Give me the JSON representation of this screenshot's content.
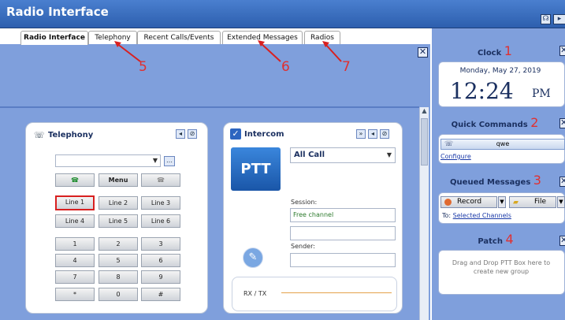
{
  "app": {
    "title": "Radio Interface"
  },
  "tabs": [
    {
      "label": "Radio Interface",
      "active": true
    },
    {
      "label": "Telephony",
      "active": false
    },
    {
      "label": "Recent Calls/Events",
      "active": false
    },
    {
      "label": "Extended Messages",
      "active": false
    },
    {
      "label": "Radios",
      "active": false
    }
  ],
  "telephony": {
    "title": "Telephony",
    "menu_label": "Menu",
    "lines": [
      "Line 1",
      "Line 2",
      "Line 3",
      "Line 4",
      "Line 5",
      "Line 6"
    ],
    "selected_line": "Line 1",
    "keypad": [
      "1",
      "2",
      "3",
      "4",
      "5",
      "6",
      "7",
      "8",
      "9",
      "*",
      "0",
      "#"
    ]
  },
  "intercom": {
    "title": "Intercom",
    "ptt_label": "PTT",
    "group_select": "All Call",
    "session_label": "Session:",
    "session_value": "Free channel",
    "sender_label": "Sender:",
    "rxtx_label": "RX / TX"
  },
  "right_panel": {
    "clock": {
      "title": "Clock",
      "date": "Monday, May 27, 2019",
      "time": "12:24",
      "ampm": "PM"
    },
    "quick_commands": {
      "title": "Quick Commands",
      "button": "qwe",
      "configure": "Configure"
    },
    "queued_messages": {
      "title": "Queued Messages",
      "record": "Record",
      "file": "File",
      "to_prefix": "To:",
      "to_link": "Selected Channels"
    },
    "patch": {
      "title": "Patch",
      "placeholder": "Drag and Drop PTT Box here to create new group"
    }
  },
  "annotations": [
    "1",
    "2",
    "3",
    "4",
    "5",
    "6",
    "7"
  ],
  "colors": {
    "title_bar": "#2d5fae",
    "main_bg": "#7f9fdc",
    "annotation": "#e03030",
    "selected_line_border": "#d82020",
    "ptt_bg": "#1e63b8"
  }
}
